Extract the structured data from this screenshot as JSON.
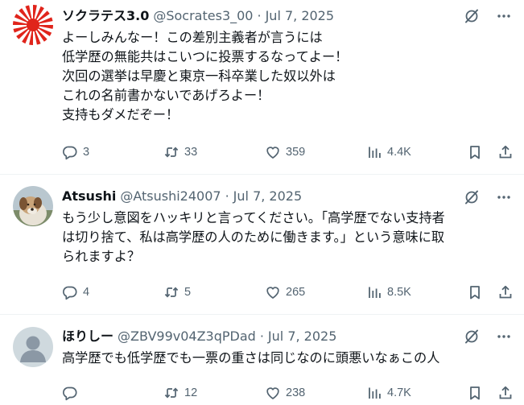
{
  "tweets": [
    {
      "display_name": "ソクラテス3.0",
      "handle": "@Socrates3_00",
      "separator": "·",
      "date": "Jul 7, 2025",
      "avatar": "rising-sun-flag",
      "text_lines": [
        "よーしみんなー！この差別主義者が言うには",
        "低学歴の無能共はこいつに投票するなってよー！",
        "次回の選挙は早慶と東京一科卒業した奴以外は",
        "これの名前書かないであげろよー！",
        "支持もダメだぞー！"
      ],
      "replies": "3",
      "reposts": "33",
      "likes": "359",
      "views": "4.4K"
    },
    {
      "display_name": "Atsushi",
      "handle": "@Atsushi24007",
      "separator": "·",
      "date": "Jul 7, 2025",
      "avatar": "dog-photo",
      "text_lines": [
        "もう少し意図をハッキリと言ってください。「高学歴でない支持者",
        "は切り捨て、私は高学歴の人のために働きます。」という意味に取",
        "られますよ？"
      ],
      "replies": "4",
      "reposts": "5",
      "likes": "265",
      "views": "8.5K"
    },
    {
      "display_name": "ほりしー",
      "handle": "@ZBV99v04Z3qPDad",
      "separator": "·",
      "date": "Jul 7, 2025",
      "avatar": "default-avatar",
      "text_lines": [
        "高学歴でも低学歴でも一票の重さは同じなのに頭悪いなぁこの人"
      ],
      "replies": "",
      "reposts": "12",
      "likes": "238",
      "views": "4.7K"
    }
  ],
  "icons": {
    "grok": "grok-icon",
    "more": "more-icon",
    "reply": "reply-icon",
    "repost": "repost-icon",
    "like": "like-icon",
    "views": "views-icon",
    "bookmark": "bookmark-icon",
    "share": "share-icon"
  },
  "colors": {
    "text": "#0f1419",
    "secondary": "#536471",
    "divider": "#eff3f4",
    "flag_red": "#e0241b"
  }
}
